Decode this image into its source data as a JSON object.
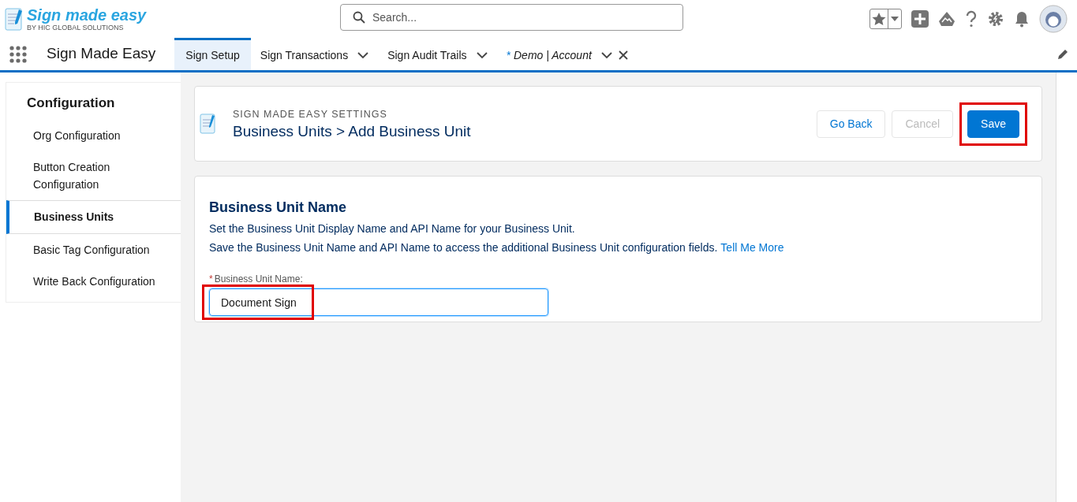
{
  "logo": {
    "title": "Sign made easy",
    "subtitle": "BY HIC GLOBAL SOLUTIONS"
  },
  "search": {
    "placeholder": "Search..."
  },
  "app_name": "Sign Made Easy",
  "tabs": [
    {
      "label": "Sign Setup",
      "selected": true,
      "dropdown": false,
      "closable": false,
      "italic": false
    },
    {
      "label": "Sign Transactions",
      "selected": false,
      "dropdown": true,
      "closable": false,
      "italic": false
    },
    {
      "label": "Sign Audit Trails",
      "selected": false,
      "dropdown": true,
      "closable": false,
      "italic": false
    },
    {
      "label": "Demo | Account",
      "selected": false,
      "dropdown": true,
      "closable": true,
      "italic": true,
      "unsaved_mark": "*"
    }
  ],
  "sidebar": {
    "title": "Configuration",
    "items": [
      {
        "label": "Org Configuration",
        "selected": false
      },
      {
        "label": "Button Creation Configuration",
        "selected": false
      },
      {
        "label": "Business Units",
        "selected": true
      },
      {
        "label": "Basic Tag Configuration",
        "selected": false
      },
      {
        "label": "Write Back Configuration",
        "selected": false
      }
    ]
  },
  "header": {
    "eyebrow": "SIGN MADE EASY SETTINGS",
    "title": "Business Units > Add Business Unit",
    "buttons": [
      {
        "label": "Go Back",
        "kind": "neutral",
        "highlighted": false
      },
      {
        "label": "Cancel",
        "kind": "disabled",
        "highlighted": false
      },
      {
        "label": "Save",
        "kind": "brand",
        "highlighted": true
      }
    ]
  },
  "form": {
    "title": "Business Unit Name",
    "description": "Set the Business Unit Display Name and API Name for your Business Unit.",
    "description_2": "Save the Business Unit Name and API Name to access the additional Business Unit configuration fields.",
    "link": "Tell Me More",
    "field": {
      "label": "Business Unit Name:",
      "required": true,
      "value": "Document Sign",
      "highlighted": true
    }
  }
}
